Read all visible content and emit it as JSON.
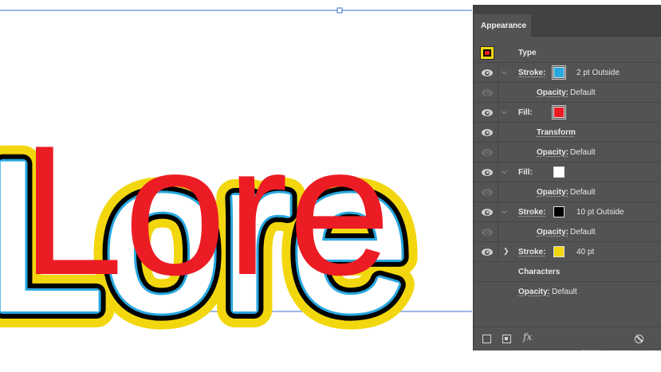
{
  "artwork": {
    "text": "Lore",
    "colors": {
      "fill": "#ec1c24",
      "inner_fill": "#ffffff",
      "stroke_outer": "#f2d70f",
      "stroke_mid": "#000000",
      "stroke_inner": "#29a8e0",
      "guide": "#3b6fd1"
    }
  },
  "panel": {
    "title": "Appearance",
    "rows": [
      {
        "id": "type",
        "label": "Type",
        "eye": "none"
      },
      {
        "id": "stroke-blue",
        "label": "Stroke:",
        "value": "2 pt  Outside",
        "eye": "on",
        "chevron": "down",
        "swatch": "#29a8e0"
      },
      {
        "id": "opacity-1",
        "label": "Opacity:",
        "value": "Default",
        "eye": "dim",
        "indent": true
      },
      {
        "id": "fill-red",
        "label": "Fill:",
        "eye": "on",
        "chevron": "down",
        "swatch": "#ec1c24"
      },
      {
        "id": "transform",
        "label": "Transform",
        "eye": "on",
        "indent": true
      },
      {
        "id": "opacity-2",
        "label": "Opacity:",
        "value": "Default",
        "eye": "dim",
        "indent": true
      },
      {
        "id": "fill-white",
        "label": "Fill:",
        "eye": "on",
        "chevron": "down",
        "swatch": "#ffffff"
      },
      {
        "id": "opacity-3",
        "label": "Opacity:",
        "value": "Default",
        "eye": "dim",
        "indent": true
      },
      {
        "id": "stroke-black",
        "label": "Stroke:",
        "value": "10 pt  Outside",
        "eye": "on",
        "chevron": "down",
        "swatch": "#000000"
      },
      {
        "id": "opacity-4",
        "label": "Opacity:",
        "value": "Default",
        "eye": "dim",
        "indent": true
      },
      {
        "id": "stroke-yellow",
        "label": "Stroke:",
        "value": "40 pt",
        "eye": "on",
        "chevron": "right",
        "swatch": "#f2d70f"
      },
      {
        "id": "characters",
        "label": "Characters",
        "eye": "none"
      },
      {
        "id": "opacity-5",
        "label": "Opacity:",
        "value": "Default",
        "eye": "none"
      }
    ],
    "footer": {
      "fx_label": "fx"
    }
  }
}
